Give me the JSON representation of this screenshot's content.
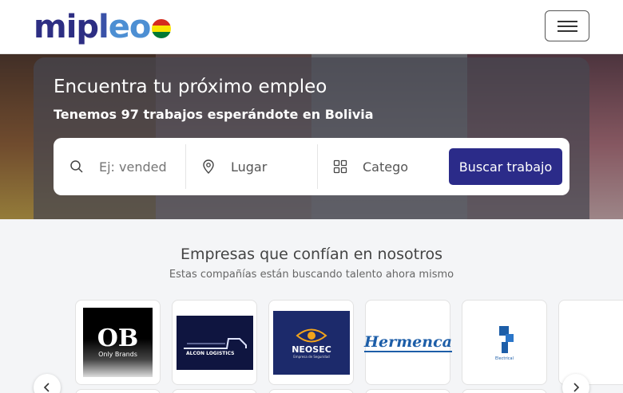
{
  "header": {
    "logo_text": "mipleo",
    "menu_label": "Toggle navigation"
  },
  "hero": {
    "title": "Encuentra tu próximo empleo",
    "subtitle": "Tenemos 97 trabajos esperándote en Bolivia"
  },
  "search": {
    "keyword_placeholder": "Ej: vended",
    "location_value": "Lugar",
    "category_value": "Catego",
    "button_label": "Buscar trabajo"
  },
  "companies": {
    "title": "Empresas que confían en nosotros",
    "subtitle": "Estas compañías están buscando talento ahora mismo",
    "logos": [
      {
        "name": "OB",
        "caption": "Only Brands"
      },
      {
        "name": "ALCON LOGISTICS"
      },
      {
        "name": "NEOSEC",
        "caption": "Empresa de Seguridad"
      },
      {
        "name": "Hermenca"
      },
      {
        "name": "Electrical"
      }
    ]
  },
  "icons": {
    "search": "search-icon",
    "location": "map-pin-icon",
    "category": "grid-icon",
    "prev": "chevron-left-icon",
    "next": "chevron-right-icon"
  },
  "colors": {
    "brand": "#2d2e83",
    "button": "#2b2b89"
  }
}
